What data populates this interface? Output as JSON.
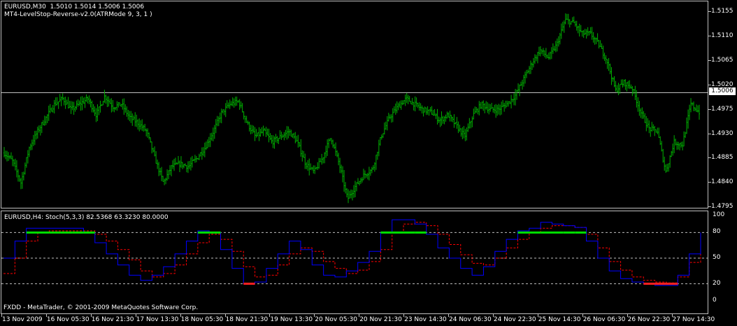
{
  "main_chart": {
    "header_line1": "EURUSD,M30  1.5010 1.5014 1.5006 1.5006",
    "header_line2": "MT4-LevelStop-Reverse-v2.0(ATRMode 9, 3, 1 )",
    "current_price": "1.5006",
    "bar_color": "#00b000",
    "price_labels": [
      "1.5155",
      "1.5110",
      "1.5065",
      "1.5020",
      "1.4975",
      "1.4930",
      "1.4885",
      "1.4840",
      "1.4795"
    ]
  },
  "chart_data": [
    {
      "type": "bar",
      "title": "EURUSD,M30",
      "ylim": [
        1.4795,
        1.5155
      ],
      "current_price": 1.5006,
      "close_trace": [
        1.4895,
        1.488,
        1.484,
        1.4905,
        1.4935,
        1.496,
        1.4985,
        1.4995,
        1.4975,
        1.4985,
        1.4995,
        1.4965,
        1.5,
        1.498,
        1.4985,
        1.496,
        1.495,
        1.4935,
        1.4885,
        1.484,
        1.487,
        1.4875,
        1.487,
        1.4885,
        1.4905,
        1.4935,
        1.497,
        1.4985,
        1.499,
        1.495,
        1.4925,
        1.4935,
        1.4915,
        1.4925,
        1.4935,
        1.4915,
        1.4875,
        1.486,
        1.4885,
        1.4925,
        1.4875,
        1.481,
        1.4835,
        1.4855,
        1.4865,
        1.4925,
        1.496,
        1.498,
        1.4995,
        1.4985,
        1.4975,
        1.497,
        1.4955,
        1.4965,
        1.4945,
        1.4925,
        1.4965,
        1.4985,
        1.4975,
        1.4975,
        1.4985,
        1.5,
        1.503,
        1.506,
        1.5085,
        1.507,
        1.5095,
        1.514,
        1.5135,
        1.5115,
        1.5115,
        1.5095,
        1.5065,
        1.501,
        1.5025,
        1.5015,
        1.497,
        1.494,
        1.4935,
        1.486,
        1.4915,
        1.491,
        1.4985,
        1.497
      ]
    },
    {
      "type": "line",
      "title": "EURUSD,H4: Stoch(5,3,3)",
      "ylim": [
        0,
        100
      ],
      "levels": [
        20,
        50,
        80
      ],
      "series": [
        {
          "name": "main",
          "color": "#0000ff",
          "values": [
            50,
            70,
            85,
            85,
            85,
            85,
            85,
            80,
            68,
            55,
            42,
            30,
            24,
            30,
            40,
            55,
            70,
            82,
            80,
            60,
            38,
            20,
            22,
            38,
            55,
            70,
            60,
            42,
            30,
            28,
            35,
            45,
            58,
            80,
            95,
            95,
            90,
            78,
            62,
            50,
            38,
            30,
            40,
            58,
            72,
            82,
            85,
            92,
            90,
            88,
            86,
            70,
            50,
            35,
            26,
            22,
            20,
            18,
            18,
            30,
            55,
            80
          ]
        },
        {
          "name": "signal",
          "color": "#ff0000",
          "values": [
            32,
            50,
            70,
            80,
            82,
            82,
            82,
            82,
            78,
            70,
            60,
            48,
            35,
            28,
            32,
            42,
            55,
            68,
            78,
            72,
            58,
            40,
            28,
            30,
            42,
            55,
            62,
            58,
            46,
            38,
            32,
            36,
            46,
            60,
            80,
            90,
            92,
            88,
            78,
            66,
            54,
            44,
            42,
            50,
            62,
            72,
            80,
            85,
            88,
            88,
            86,
            78,
            62,
            46,
            36,
            28,
            24,
            22,
            21,
            28,
            45,
            72
          ]
        }
      ]
    }
  ],
  "stoch_panel": {
    "header": "EURUSD,H4: Stoch(5,3,3) 82.5368 63.3230 80.0000",
    "copyright": "FXDD - MetaTrader, © 2001-2009 MetaQuotes Software Corp.",
    "level_labels": [
      "100",
      "80",
      "50",
      "20",
      "0"
    ]
  },
  "time_axis": {
    "labels": [
      "13 Nov 2009",
      "16 Nov 05:30",
      "16 Nov 21:30",
      "17 Nov 13:30",
      "18 Nov 05:30",
      "18 Nov 21:30",
      "19 Nov 13:30",
      "20 Nov 05:30",
      "20 Nov 21:30",
      "23 Nov 14:30",
      "24 Nov 06:30",
      "24 Nov 22:30",
      "25 Nov 14:30",
      "26 Nov 06:30",
      "26 Nov 22:30",
      "27 Nov 14:30"
    ]
  }
}
